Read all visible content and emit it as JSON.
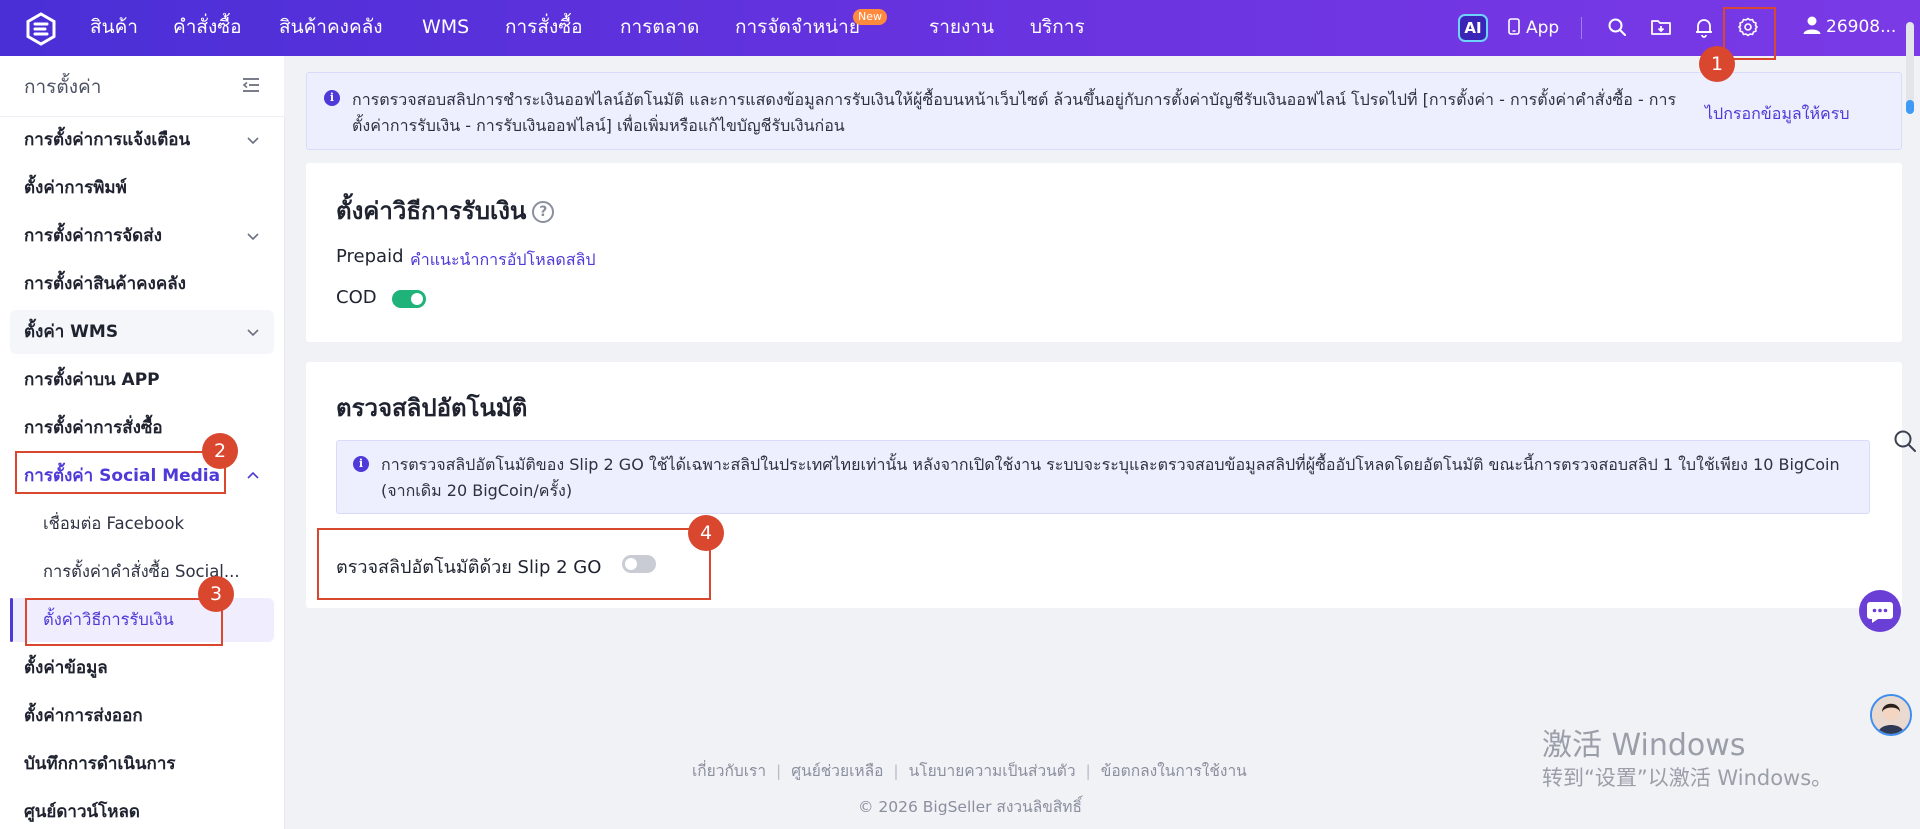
{
  "nav": {
    "items": [
      "สินค้า",
      "คำสั่งซื้อ",
      "สินค้าคงคลัง",
      "WMS",
      "การสั่งซื้อ",
      "การตลาด",
      "การจัดจำหน่าย",
      "รายงาน",
      "บริการ"
    ],
    "new_badge": "New",
    "ai_label": "AI",
    "app_label": "App",
    "user_label": "26908..."
  },
  "sidebar": {
    "title": "การตั้งค่า",
    "items": [
      {
        "label": "การตั้งค่าการแจ้งเตือน"
      },
      {
        "label": "ตั้งค่าการพิมพ์"
      },
      {
        "label": "การตั้งค่าการจัดส่ง"
      },
      {
        "label": "การตั้งค่าสินค้าคงคลัง"
      },
      {
        "label": "ตั้งค่า WMS"
      },
      {
        "label": "การตั้งค่าบน APP"
      },
      {
        "label": "การตั้งค่าการสั่งซื้อ"
      },
      {
        "label": "การตั้งค่า Social Media"
      },
      {
        "label": "เชื่อมต่อ Facebook"
      },
      {
        "label": "การตั้งค่าคำสั่งซื้อ Social..."
      },
      {
        "label": "ตั้งค่าวิธีการรับเงิน"
      },
      {
        "label": "ตั้งค่าข้อมูล"
      },
      {
        "label": "ตั้งค่าการส่งออก"
      },
      {
        "label": "บันทึกการดำเนินการ"
      },
      {
        "label": "ศูนย์ดาวน์โหลด"
      }
    ]
  },
  "top_notice": {
    "text": "การตรวจสอบสลิปการชำระเงินออฟไลน์อัตโนมัติ และการแสดงข้อมูลการรับเงินให้ผู้ซื้อบนหน้าเว็บไซต์ ล้วนขึ้นอยู่กับการตั้งค่าบัญชีรับเงินออฟไลน์ โปรดไปที่ [การตั้งค่า - การตั้งค่าคำสั่งซื้อ - การตั้งค่าการรับเงิน - การรับเงินออฟไลน์] เพื่อเพิ่มหรือแก้ไขบัญชีรับเงินก่อน",
    "link": "ไปกรอกข้อมูลให้ครบ"
  },
  "payment_card": {
    "title": "ตั้งค่าวิธีการรับเงิน",
    "help": "?",
    "prepaid_label": "Prepaid",
    "prepaid_link": "คำแนะนำการอัปโหลดสลิป",
    "cod_label": "COD"
  },
  "slip_card": {
    "title": "ตรวจสลิปอัตโนมัติ",
    "notice": "การตรวจสลิปอัตโนมัติของ Slip 2 GO ใช้ได้เฉพาะสลิปในประเทศไทยเท่านั้น หลังจากเปิดใช้งาน ระบบจะระบุและตรวจสอบข้อมูลสลิปที่ผู้ซื้ออัปโหลดโดยอัตโนมัติ ขณะนี้การตรวจสอบสลิป 1 ใบใช้เพียง 10 BigCoin (จากเดิม 20 BigCoin/ครั้ง)",
    "toggle_label": "ตรวจสลิปอัตโนมัติด้วย Slip 2 GO"
  },
  "annotations": [
    "1",
    "2",
    "3",
    "4"
  ],
  "footer": {
    "links": [
      "เกี่ยวกับเรา",
      "ศูนย์ช่วยเหลือ",
      "นโยบายความเป็นส่วนตัว",
      "ข้อตกลงในการใช้งาน"
    ],
    "copyright": "© 2026 BigSeller สงวนลิขสิทธิ์"
  },
  "watermark": {
    "line1": "激活 Windows",
    "line2": "转到“设置”以激活 Windows。"
  },
  "colors": {
    "accent": "#4e3ad8",
    "toggle_on": "#1fb37a",
    "annotation": "#d9472f"
  }
}
